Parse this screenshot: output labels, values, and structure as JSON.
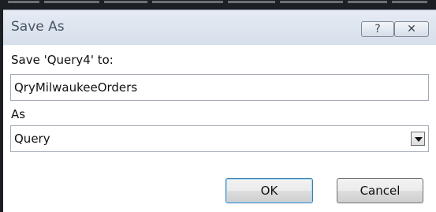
{
  "window": {
    "title": "Save As",
    "help_glyph": "?",
    "close_glyph": "✕"
  },
  "form": {
    "save_label": "Save 'Query4' to:",
    "name_value": "QryMilwaukeeOrders",
    "as_label": "As",
    "as_value": "Query"
  },
  "buttons": {
    "ok": "OK",
    "cancel": "Cancel"
  },
  "icons": {
    "help": "help-icon",
    "close": "close-icon",
    "dropdown": "chevron-down-icon"
  }
}
